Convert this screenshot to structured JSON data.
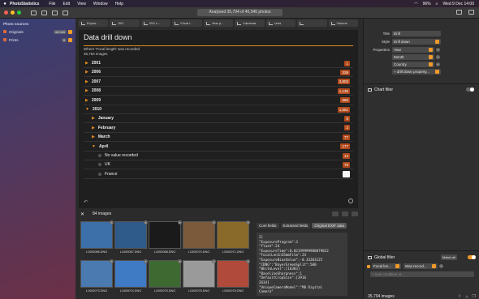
{
  "menubar": {
    "apple": "",
    "app_name": "PhotoStatistics",
    "items": [
      "File",
      "Edit",
      "View",
      "Window",
      "Help"
    ],
    "battery": "96%",
    "datetime": "Wed 9 Dec  14:00"
  },
  "toolbar": {
    "status": "Analysed 35,794 of 40,945 photos"
  },
  "sidebar": {
    "heading": "Photo sources",
    "sources": [
      {
        "label": "Originals",
        "count": "40,945"
      },
      {
        "label": "Prints",
        "count": "8"
      }
    ]
  },
  "chart_tabs": [
    "Expos...",
    "ISO",
    "ISO v...",
    "Focal l...",
    "Year p...",
    "Cameras",
    "Lens",
    "",
    "Volume"
  ],
  "chart": {
    "title": "Data drill down",
    "subtitle": "Where 'Focal length' was recorded",
    "count": "35,794 images",
    "rows": [
      {
        "label": "2001",
        "value": "1",
        "indent": 0,
        "open": false
      },
      {
        "label": "2006",
        "value": "339",
        "indent": 0,
        "open": false
      },
      {
        "label": "2007",
        "value": "3,803",
        "indent": 0,
        "open": false
      },
      {
        "label": "2008",
        "value": "1,135",
        "indent": 0,
        "open": false
      },
      {
        "label": "2009",
        "value": "586",
        "indent": 0,
        "open": false
      },
      {
        "label": "2010",
        "value": "1,651",
        "indent": 0,
        "open": true
      },
      {
        "label": "January",
        "value": "5",
        "indent": 1,
        "open": false
      },
      {
        "label": "February",
        "value": "2",
        "indent": 1,
        "open": false
      },
      {
        "label": "March",
        "value": "77",
        "indent": 1,
        "open": false
      },
      {
        "label": "April",
        "value": "177",
        "indent": 1,
        "open": true
      },
      {
        "label": "No value recorded",
        "value": "14",
        "indent": 2,
        "open": false
      },
      {
        "label": "UK",
        "value": "79",
        "indent": 2,
        "open": false
      },
      {
        "label": "France",
        "value": "",
        "indent": 2,
        "open": false
      }
    ]
  },
  "images": {
    "count_label": "84 images",
    "thumbs": [
      {
        "name": "L1000086.DNG",
        "color": "#3d6fa8"
      },
      {
        "name": "L1000087.DNG",
        "color": "#2e5b8a"
      },
      {
        "name": "L1000088.DNG",
        "color": "#1a1a1a"
      },
      {
        "name": "L1000070.DNG",
        "color": "#7a5a3a"
      },
      {
        "name": "L1000071.DNG",
        "color": "#8a6a2a"
      },
      {
        "name": "L1000073.DNG",
        "color": "#4a7ab0"
      },
      {
        "name": "L1000074.DNG",
        "color": "#3f7ac4"
      },
      {
        "name": "L1000075.DNG",
        "color": "#3e6a32"
      },
      {
        "name": "L1000076.DNG",
        "color": "#9a9a9a"
      },
      {
        "name": "L1000078.DNG",
        "color": "#b04a3a"
      }
    ]
  },
  "exif": {
    "tabs": [
      "Core fields",
      "Extracted fields",
      "Original EXIF data"
    ],
    "lines": [
      "2]",
      "\"ExposureProgram\":3",
      "\"Flash\":24",
      "\"ExposureTime\":0.02199999988079822",
      "\"FocalLenIn35mmFilm\":24",
      "\"ExposureBiasValue\":-0.33203125",
      "\"CDNG\":\"BayerGreenSplit\":500",
      "\"WhiteLevel\":[16383]",
      "\"BaselineSharpness\":1",
      "\"DefaultCropSize\":[3916",
      "2634]",
      "\"UniqueCameraModel\":\"M8 Digital",
      "Camera\""
    ]
  },
  "inspector": {
    "title_label": "Title",
    "title_value": "Drill",
    "style_label": "Style",
    "style_value": "Drill down",
    "properties_label": "Properties",
    "properties": [
      "Year",
      "Month",
      "Country"
    ],
    "add_property": "+ drill down property...",
    "chart_filter": "Chart filter",
    "global_filter": "Global filter",
    "match": "Match all",
    "filter_field": "Focal len...",
    "filter_op": "Was record...",
    "new_condition": "+ new condition or...",
    "total": "35,794 images"
  },
  "colors": {
    "accent": "#f09a2a",
    "bar": "#b34a1c"
  }
}
